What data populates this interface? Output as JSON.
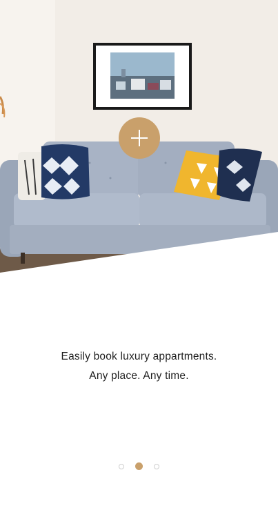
{
  "onboarding": {
    "line1": "Easily book luxury  appartments.",
    "line2": "Any place. Any time."
  },
  "pagination": {
    "total": 3,
    "current": 2
  },
  "colors": {
    "accent": "#c9a06b",
    "sofa": "#a9b4c6",
    "wall": "#f3eee8"
  },
  "icons": {
    "add": "plus-icon"
  }
}
